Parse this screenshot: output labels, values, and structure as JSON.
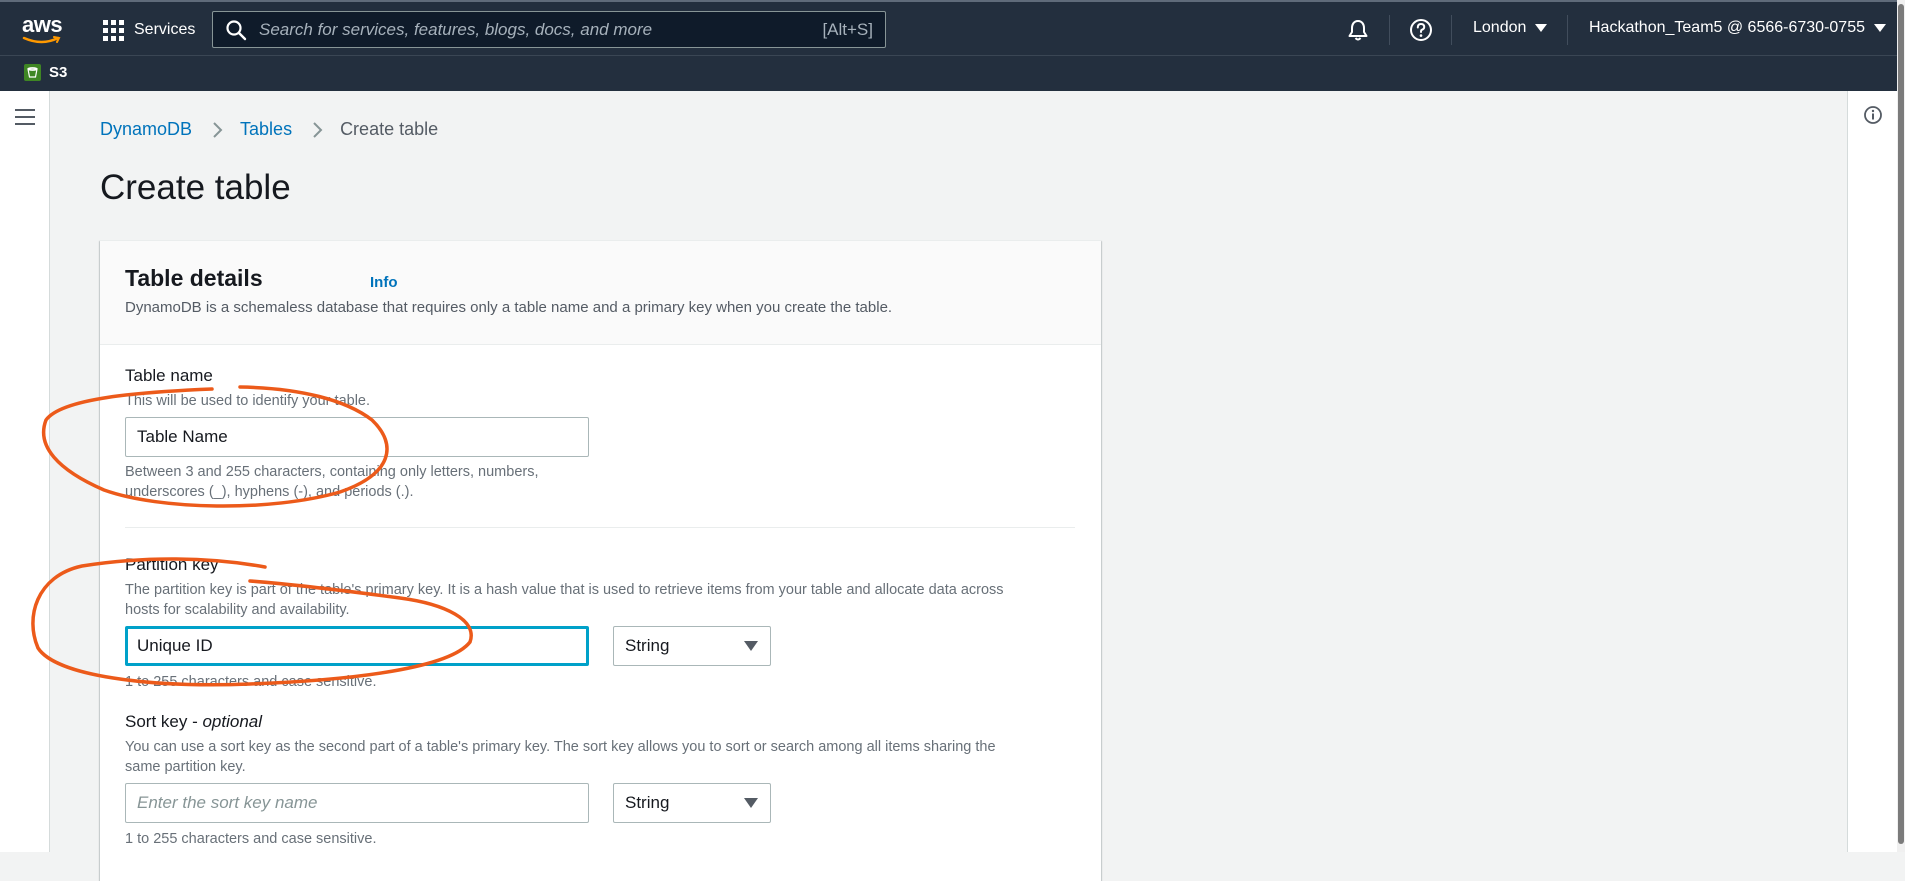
{
  "nav": {
    "logo": "aws",
    "services": "Services",
    "search_placeholder": "Search for services, features, blogs, docs, and more",
    "search_shortcut": "[Alt+S]",
    "region": "London",
    "account": "Hackathon_Team5 @ 6566-6730-0755"
  },
  "favorites": [
    {
      "label": "S3"
    }
  ],
  "breadcrumb": {
    "items": [
      "DynamoDB",
      "Tables"
    ],
    "current": "Create table"
  },
  "page": {
    "title": "Create table"
  },
  "table_details": {
    "title": "Table details",
    "info": "Info",
    "description": "DynamoDB is a schemaless database that requires only a table name and a primary key when you create the table."
  },
  "table_name": {
    "label": "Table name",
    "description": "This will be used to identify your table.",
    "value": "Table Name",
    "constraint_line1": "Between 3 and 255 characters, containing only letters, numbers,",
    "constraint_line2": "underscores (_), hyphens (-), and periods (.)."
  },
  "partition_key": {
    "label": "Partition key",
    "description_line1": "The partition key is part of the table's primary key. It is a hash value that is used to retrieve items from your table and allocate data across",
    "description_line2": "hosts for scalability and availability.",
    "value": "Unique ID",
    "type": "String",
    "constraint": "1 to 255 characters and case sensitive."
  },
  "sort_key": {
    "label": "Sort key - ",
    "label_optional": "optional",
    "description_line1": "You can use a sort key as the second part of a table's primary key. The sort key allows you to sort or search among all items sharing the",
    "description_line2": "same partition key.",
    "placeholder": "Enter the sort key name",
    "type": "String",
    "constraint": "1 to 255 characters and case sensitive."
  },
  "colors": {
    "nav_bg": "#232f3e",
    "link": "#0073bb",
    "focus": "#00a1c9",
    "annotation": "#ec5a1a",
    "s3_green": "#3f8624"
  },
  "icons": [
    "grid-icon",
    "search-icon",
    "bell-icon",
    "help-icon",
    "s3-icon",
    "hamburger-icon",
    "chevron-right-icon",
    "info-icon"
  ]
}
